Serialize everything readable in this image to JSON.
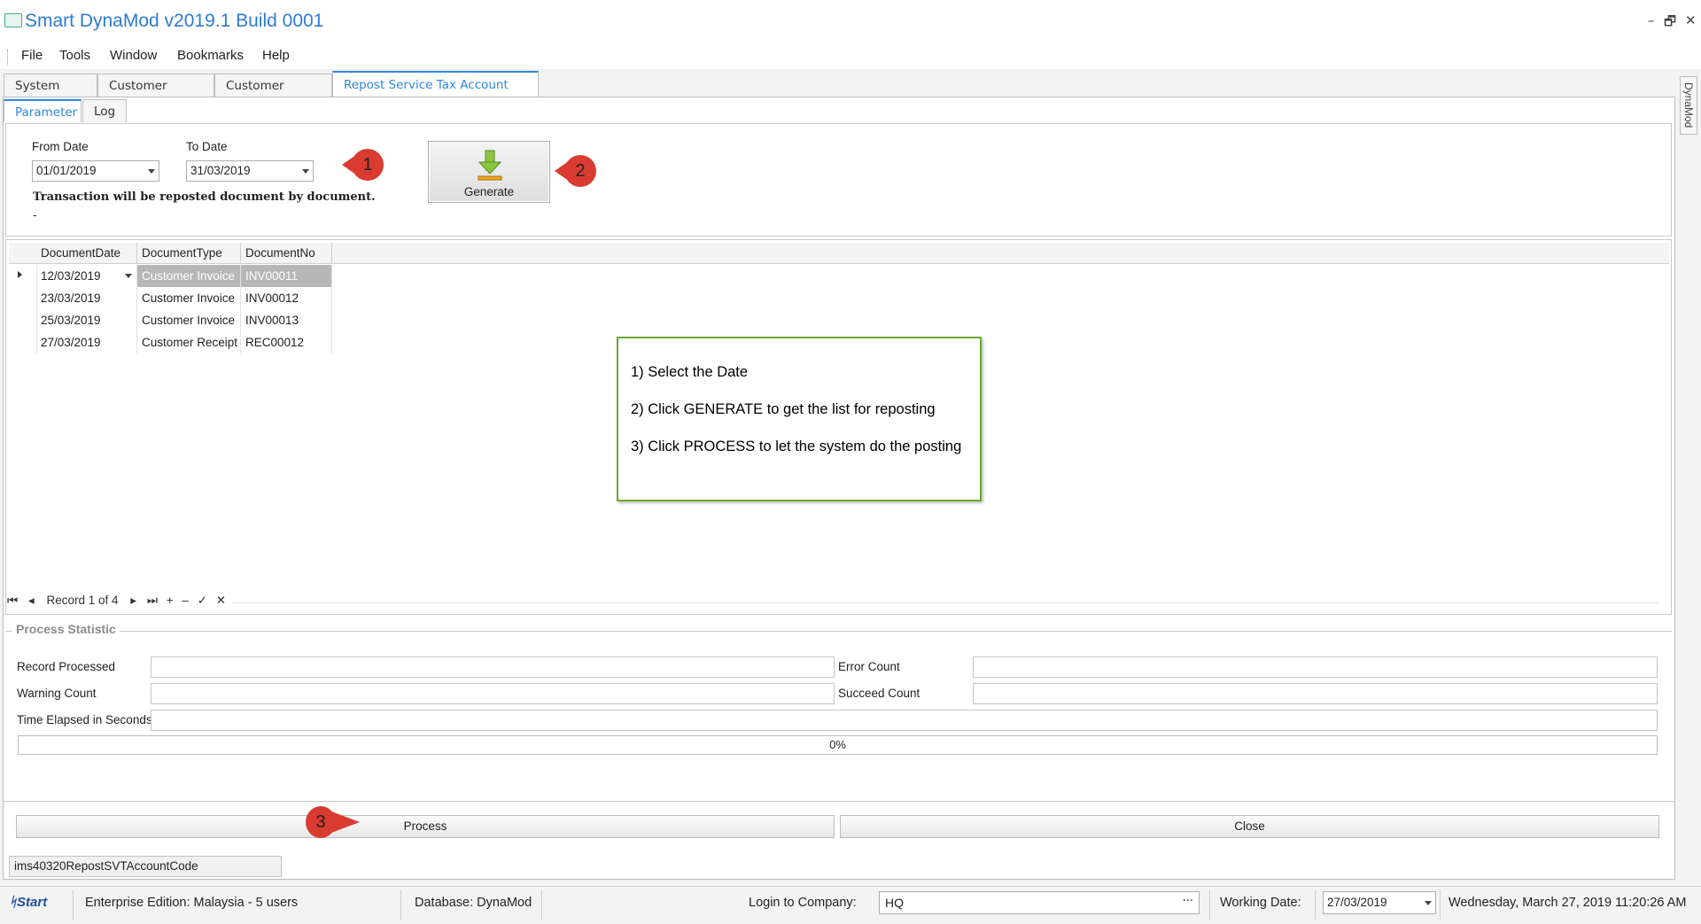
{
  "app": {
    "title": "Smart DynaMod v2019.1 Build 0001"
  },
  "window_controls": {
    "minimize": "–",
    "restore": "🗗",
    "close": "✕"
  },
  "menu": [
    "File",
    "Tools",
    "Window",
    "Bookmarks",
    "Help"
  ],
  "doc_tabs": [
    "System Menu",
    "Customer Invoice",
    "Customer Receipt",
    "Repost Service Tax Account Code"
  ],
  "active_doc_tab": "Repost Service Tax Account Code",
  "side_tab": "DynaMod",
  "sub_tabs": [
    "Parameter",
    "Log"
  ],
  "params": {
    "from_label": "From Date",
    "from_value": "01/01/2019",
    "to_label": "To Date",
    "to_value": "31/03/2019",
    "note": "Transaction will be reposted document by document.",
    "dash": "-",
    "generate": "Generate"
  },
  "callouts": [
    "1",
    "2",
    "3"
  ],
  "grid": {
    "headers": [
      "DocumentDate",
      "DocumentType",
      "DocumentNo"
    ],
    "rows": [
      [
        "12/03/2019",
        "Customer Invoice",
        "INV00011"
      ],
      [
        "23/03/2019",
        "Customer Invoice",
        "INV00012"
      ],
      [
        "25/03/2019",
        "Customer Invoice",
        "INV00013"
      ],
      [
        "27/03/2019",
        "Customer Receipt",
        "REC00012"
      ]
    ],
    "record_text": "Record 1 of 4"
  },
  "instructions": [
    "1) Select the Date",
    "2) Click GENERATE to get the list for reposting",
    "3) Click PROCESS to let the system do the posting"
  ],
  "stats": {
    "title": "Process Statistic",
    "record_processed": "Record Processed",
    "error_count": "Error Count",
    "warning_count": "Warning Count",
    "succeed_count": "Succeed Count",
    "time_elapsed": "Time Elapsed in Seconds",
    "progress_text": "0%",
    "progress": 0
  },
  "buttons": {
    "process": "Process",
    "close": "Close"
  },
  "form_name": "ims40320RepostSVTAccountCode",
  "status": {
    "start": "Start",
    "edition": "Enterprise Edition: Malaysia - 5 users",
    "database": "Database: DynaMod",
    "login_label": "Login to Company:",
    "company": "HQ",
    "ellipsis": "···",
    "working_label": "Working Date:",
    "working_date": "27/03/2019",
    "datetime": "Wednesday, March 27, 2019 11:20:26 AM"
  },
  "colors": {
    "accent": "#2e86de",
    "callout": "#d93b30",
    "note_border": "#6aa832",
    "selection": "#b7b7b7"
  }
}
